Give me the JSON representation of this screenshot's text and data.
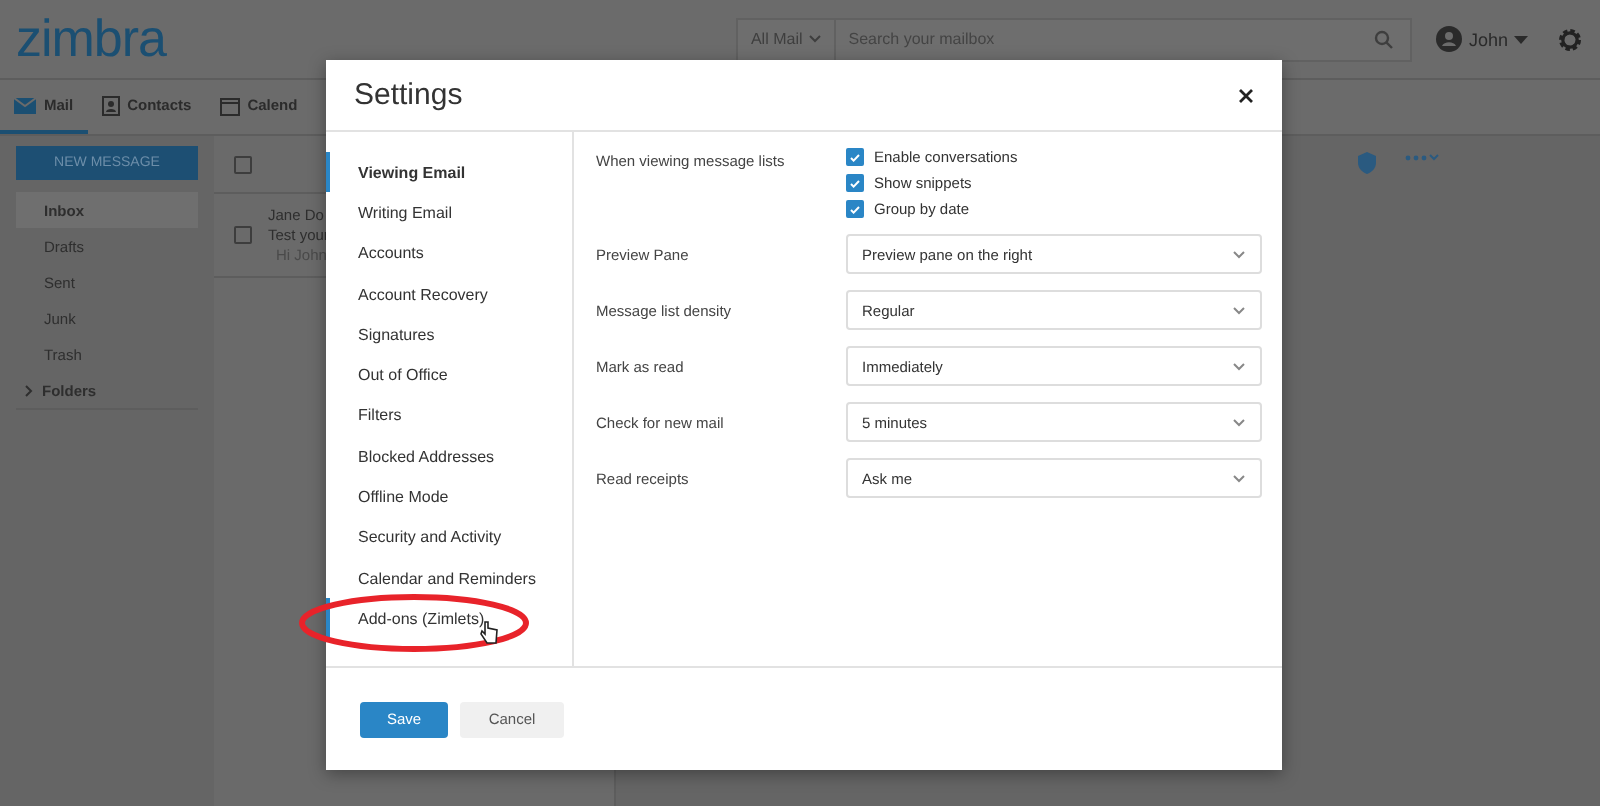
{
  "app": {
    "logo": "zimbra",
    "search": {
      "scope": "All Mail",
      "placeholder": "Search your mailbox"
    },
    "user": {
      "name": "John"
    },
    "tabs": [
      {
        "label": "Mail",
        "selected": true
      },
      {
        "label": "Contacts",
        "selected": false
      },
      {
        "label": "Calend",
        "selected": false
      }
    ],
    "new_message_button": "NEW MESSAGE",
    "folders": [
      {
        "label": "Inbox",
        "selected": true
      },
      {
        "label": "Drafts",
        "selected": false
      },
      {
        "label": "Sent",
        "selected": false
      },
      {
        "label": "Junk",
        "selected": false
      },
      {
        "label": "Trash",
        "selected": false
      }
    ],
    "folder_group": {
      "label": "Folders",
      "expanded": false
    },
    "select_all": {
      "checked": false
    },
    "messages": [
      {
        "from": "Jane Do",
        "subject": "Test your",
        "snippet": "Hi John",
        "checked": false
      }
    ]
  },
  "settings": {
    "title": "Settings",
    "nav": [
      {
        "label": "Viewing Email",
        "selected": true,
        "hovered": false
      },
      {
        "label": "Writing Email",
        "selected": false,
        "hovered": false
      },
      {
        "label": "Accounts",
        "selected": false,
        "hovered": false
      },
      {
        "label": "Account Recovery",
        "selected": false,
        "hovered": false
      },
      {
        "label": "Signatures",
        "selected": false,
        "hovered": false
      },
      {
        "label": "Out of Office",
        "selected": false,
        "hovered": false
      },
      {
        "label": "Filters",
        "selected": false,
        "hovered": false
      },
      {
        "label": "Blocked Addresses",
        "selected": false,
        "hovered": false
      },
      {
        "label": "Offline Mode",
        "selected": false,
        "hovered": false
      },
      {
        "label": "Security and Activity",
        "selected": false,
        "hovered": false
      },
      {
        "label": "Calendar and Reminders",
        "selected": false,
        "hovered": false
      },
      {
        "label": "Add-ons (Zimlets)",
        "selected": false,
        "hovered": true
      }
    ],
    "options": [
      {
        "kind": "checkboxes",
        "label": "When viewing message lists",
        "items": [
          {
            "label": "Enable conversations",
            "checked": true
          },
          {
            "label": "Show snippets",
            "checked": true
          },
          {
            "label": "Group by date",
            "checked": true
          }
        ]
      },
      {
        "kind": "select",
        "label": "Preview Pane",
        "value": "Preview pane on the right"
      },
      {
        "kind": "select",
        "label": "Message list density",
        "value": "Regular"
      },
      {
        "kind": "select",
        "label": "Mark as read",
        "value": "Immediately"
      },
      {
        "kind": "select",
        "label": "Check for new mail",
        "value": "5 minutes"
      },
      {
        "kind": "select",
        "label": "Read receipts",
        "value": "Ask me"
      }
    ],
    "buttons": {
      "save": "Save",
      "cancel": "Cancel"
    }
  }
}
